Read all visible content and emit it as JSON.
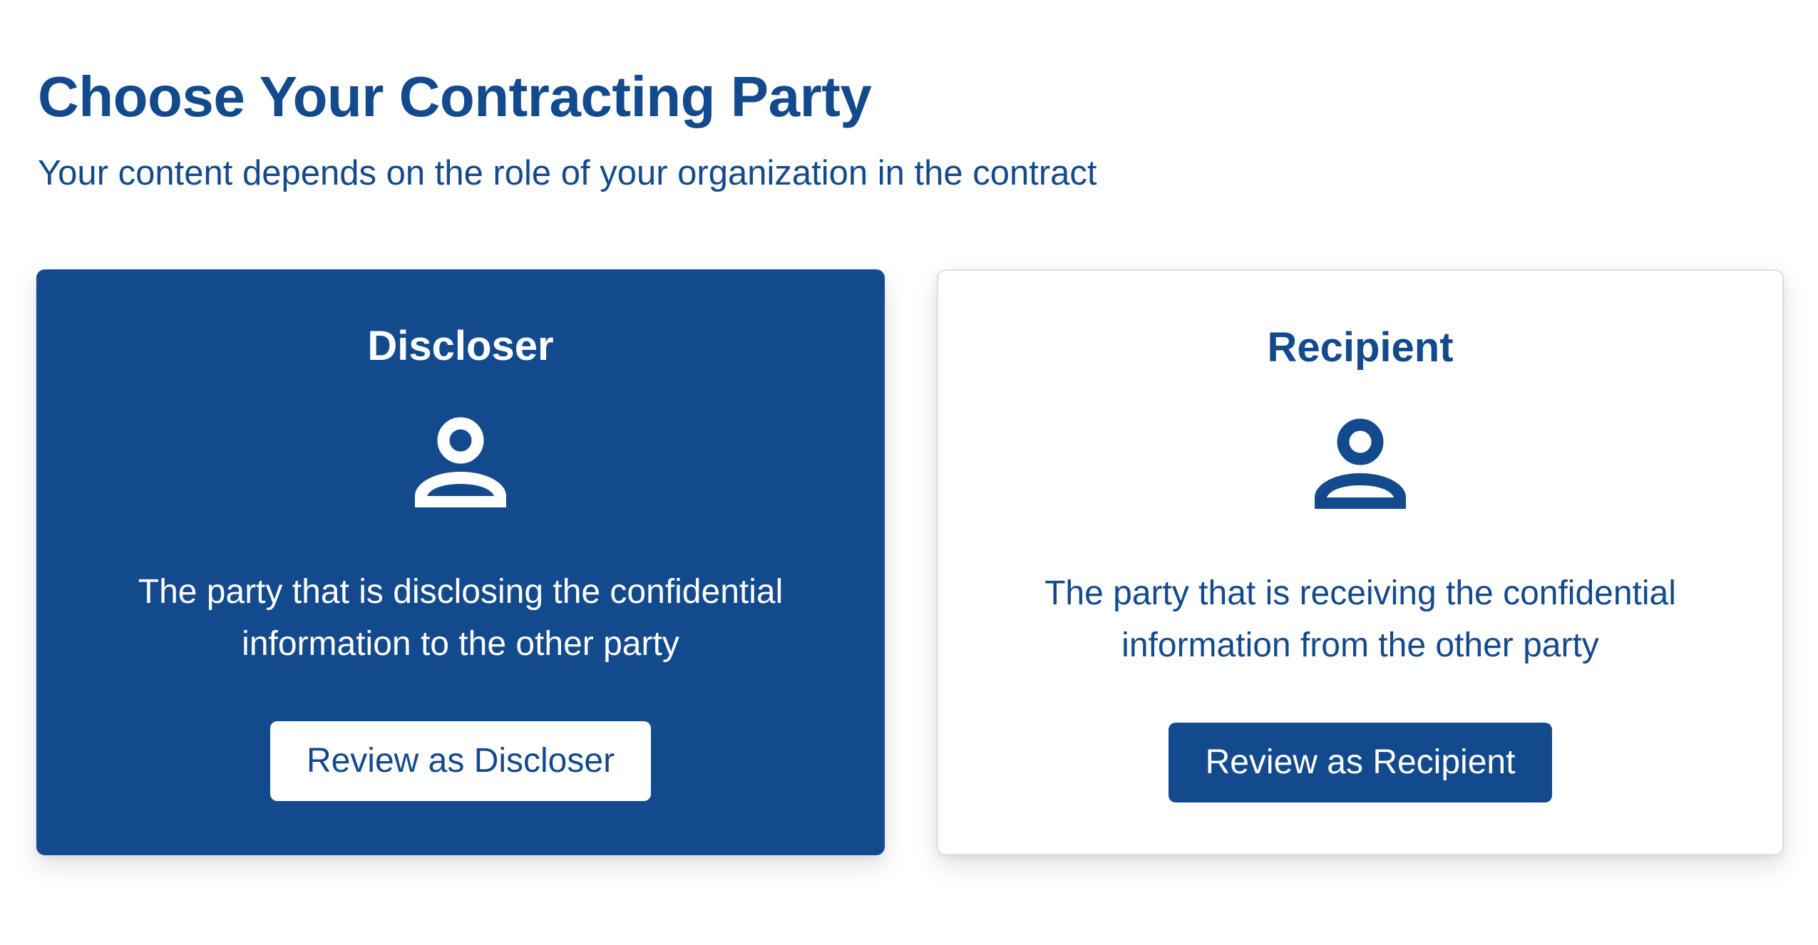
{
  "header": {
    "title": "Choose Your Contracting Party",
    "subtitle": "Your content depends on the role of your organization in the contract"
  },
  "cards": [
    {
      "id": "discloser",
      "title": "Discloser",
      "icon": "user-icon",
      "description": "The party that is disclosing the confidential information to the other party",
      "button_label": "Review as Discloser",
      "selected": true
    },
    {
      "id": "recipient",
      "title": "Recipient",
      "icon": "user-icon",
      "description": "The party that is receiving the confidential information from the other party",
      "button_label": "Review as Recipient",
      "selected": false
    }
  ],
  "colors": {
    "primary": "#134a8e",
    "background": "#ffffff",
    "card_border": "#dcdfe4"
  }
}
